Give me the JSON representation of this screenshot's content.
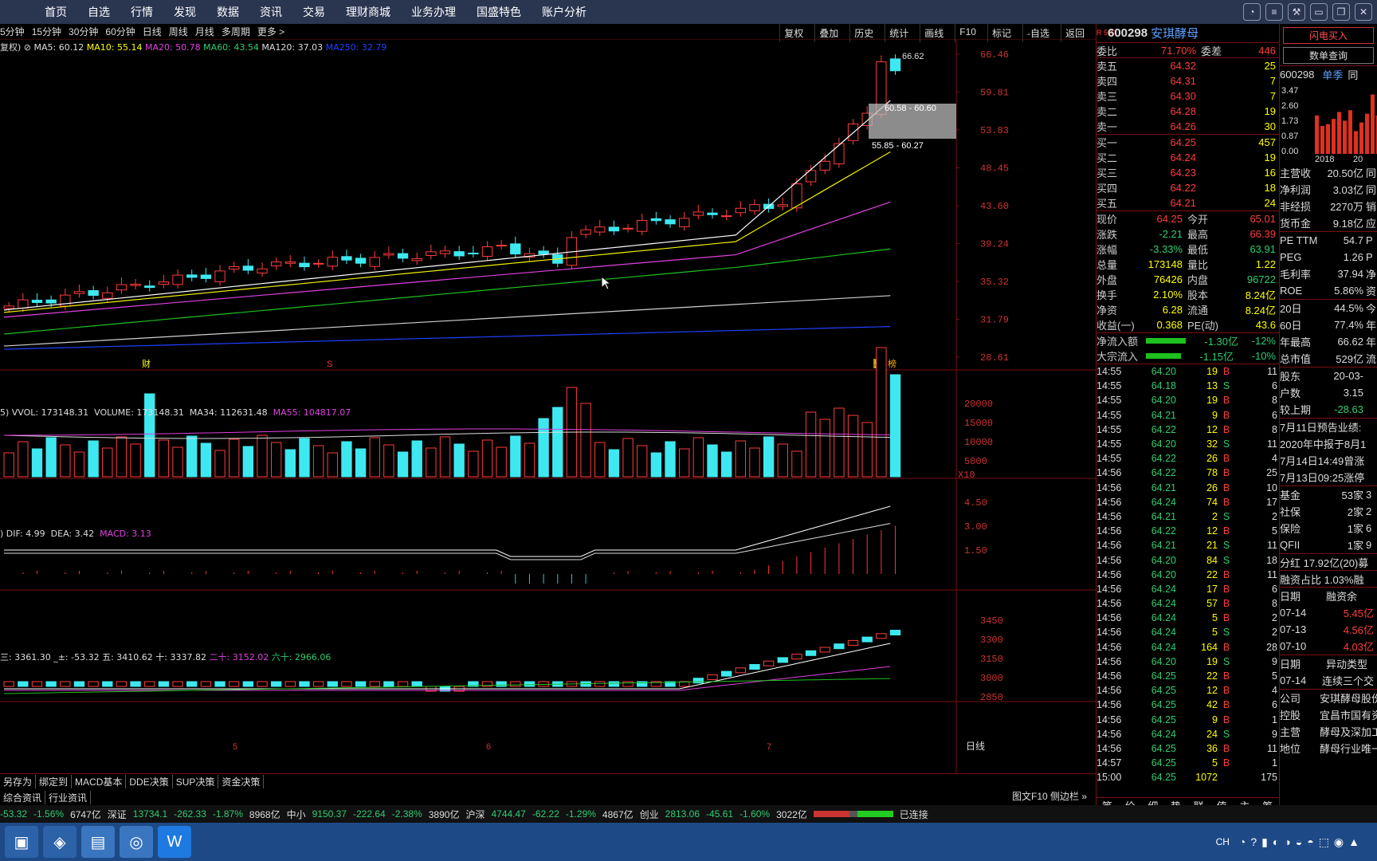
{
  "menu": [
    "首页",
    "自选",
    "行情",
    "发现",
    "数据",
    "资讯",
    "交易",
    "理财商城",
    "业务办理",
    "国盛特色",
    "账户分析"
  ],
  "periods": [
    "5分钟",
    "15分钟",
    "30分钟",
    "60分钟",
    "日线",
    "周线",
    "月线",
    "多周期",
    "更多 >"
  ],
  "tools": [
    "复权",
    "叠加",
    "历史",
    "统计",
    "画线",
    "F10",
    "标记",
    "-自选",
    "返回"
  ],
  "ma_header": {
    "prefix": "复权)",
    "ma5": "MA5: 60.12",
    "ma10": "MA10: 55.14",
    "ma20": "MA20: 50.78",
    "ma60": "MA60: 43.54",
    "ma120": "MA120: 37.03",
    "ma250": "MA250: 32.79"
  },
  "price_axis": [
    "66.46",
    "59.81",
    "53.83",
    "48.45",
    "43.60",
    "39.24",
    "35.32",
    "31.79",
    "28.61"
  ],
  "annotations": {
    "high": "66.62",
    "zone1": "60.58 - 60.60",
    "zone2": "55.85 - 60.27",
    "cai": "财",
    "s": "S",
    "yu": "预",
    "bang": "榜"
  },
  "vol_header": {
    "a": "5) VVOL: 173148.31",
    "b": "VOLUME: 173148.31",
    "c": "MA34: 112631.48",
    "d": "MA55: 104817.07"
  },
  "vol_axis": [
    "20000",
    "15000",
    "10000",
    "5000",
    "X10"
  ],
  "macd_header": {
    "a": ") DIF: 4.99",
    "b": "DEA: 3.42",
    "c": "MACD: 3.13"
  },
  "macd_axis": [
    "4.50",
    "3.00",
    "1.50"
  ],
  "idx_header": {
    "a": "三: 3361.30",
    "b": "_±: -53.32",
    "c": "五: 3410.62",
    "d": "十: 3337.82",
    "e": "二十: 3152.02",
    "f": "六十: 2966.06"
  },
  "idx_axis": [
    "3450",
    "3300",
    "3150",
    "3000",
    "2850"
  ],
  "months": [
    "5",
    "6",
    "7"
  ],
  "rixian": "日线",
  "tabs": [
    "另存为",
    "绑定到",
    "MACD基本",
    "DDE决策",
    "SUP决策",
    "资金决策"
  ],
  "tabs2": [
    "综合资讯",
    "行业资讯"
  ],
  "stock": {
    "code": "600298",
    "name": "安琪酵母",
    "badge": "R 500"
  },
  "weibi": {
    "l": "委比",
    "v": "71.70%",
    "l2": "委差",
    "v2": "446"
  },
  "asks": [
    [
      "卖五",
      "64.32",
      "25"
    ],
    [
      "卖四",
      "64.31",
      "7"
    ],
    [
      "卖三",
      "64.30",
      "7"
    ],
    [
      "卖二",
      "64.28",
      "19"
    ],
    [
      "卖一",
      "64.26",
      "30"
    ]
  ],
  "bids": [
    [
      "买一",
      "64.25",
      "457"
    ],
    [
      "买二",
      "64.24",
      "19"
    ],
    [
      "买三",
      "64.23",
      "16"
    ],
    [
      "买四",
      "64.22",
      "18"
    ],
    [
      "买五",
      "64.21",
      "24"
    ]
  ],
  "quote": [
    [
      "现价",
      "64.25",
      "今开",
      "65.01"
    ],
    [
      "涨跌",
      "-2.21",
      "最高",
      "66.39"
    ],
    [
      "涨幅",
      "-3.33%",
      "最低",
      "63.91"
    ],
    [
      "总量",
      "173148",
      "量比",
      "1.22"
    ],
    [
      "外盘",
      "76426",
      "内盘",
      "96722"
    ],
    [
      "换手",
      "2.10%",
      "股本",
      "8.24亿"
    ],
    [
      "净资",
      "6.28",
      "流通",
      "8.24亿"
    ],
    [
      "收益(一)",
      "0.368",
      "PE(动)",
      "43.6"
    ]
  ],
  "flow": [
    [
      "净流入额",
      "-1.30亿",
      "-12%"
    ],
    [
      "大宗流入",
      "-1.15亿",
      "-10%"
    ]
  ],
  "ticks": [
    [
      "14:55",
      "64.20",
      "19",
      "B",
      "11"
    ],
    [
      "14:55",
      "64.18",
      "13",
      "S",
      "6"
    ],
    [
      "14:55",
      "64.20",
      "19",
      "B",
      "8"
    ],
    [
      "14:55",
      "64.21",
      "9",
      "B",
      "6"
    ],
    [
      "14:55",
      "64.22",
      "12",
      "B",
      "8"
    ],
    [
      "14:55",
      "64.20",
      "32",
      "S",
      "11"
    ],
    [
      "14:55",
      "64.22",
      "26",
      "B",
      "4"
    ],
    [
      "14:56",
      "64.22",
      "78",
      "B",
      "25"
    ],
    [
      "14:56",
      "64.21",
      "26",
      "B",
      "10"
    ],
    [
      "14:56",
      "64.24",
      "74",
      "B",
      "17"
    ],
    [
      "14:56",
      "64.21",
      "2",
      "S",
      "2"
    ],
    [
      "14:56",
      "64.22",
      "12",
      "B",
      "5"
    ],
    [
      "14:56",
      "64.21",
      "21",
      "S",
      "11"
    ],
    [
      "14:56",
      "64.20",
      "84",
      "S",
      "18"
    ],
    [
      "14:56",
      "64.20",
      "22",
      "B",
      "11"
    ],
    [
      "14:56",
      "64.24",
      "17",
      "B",
      "6"
    ],
    [
      "14:56",
      "64.24",
      "57",
      "B",
      "8"
    ],
    [
      "14:56",
      "64.24",
      "5",
      "B",
      "2"
    ],
    [
      "14:56",
      "64.24",
      "5",
      "S",
      "2"
    ],
    [
      "14:56",
      "64.24",
      "164",
      "B",
      "28"
    ],
    [
      "14:56",
      "64.20",
      "19",
      "S",
      "9"
    ],
    [
      "14:56",
      "64.25",
      "22",
      "B",
      "5"
    ],
    [
      "14:56",
      "64.25",
      "12",
      "B",
      "4"
    ],
    [
      "14:56",
      "64.25",
      "42",
      "B",
      "6"
    ],
    [
      "14:56",
      "64.25",
      "9",
      "B",
      "1"
    ],
    [
      "14:56",
      "64.24",
      "24",
      "S",
      "9"
    ],
    [
      "14:56",
      "64.25",
      "36",
      "B",
      "11"
    ],
    [
      "14:57",
      "64.25",
      "5",
      "B",
      "1"
    ],
    [
      "15:00",
      "64.25",
      "1072",
      "",
      "175"
    ]
  ],
  "rtabs": [
    "笔",
    "价",
    "细",
    "势",
    "联",
    "值",
    "主",
    "筹"
  ],
  "far": {
    "btn1": "闪电买入",
    "btn2": "数单查询",
    "code": "600298",
    "season": "单季",
    "col": "同",
    "yaxis": [
      "3.47",
      "2.60",
      "1.73",
      "0.87",
      "0.00"
    ],
    "years": [
      "2018",
      "20"
    ],
    "bars": [
      2.2,
      1.6,
      1.7,
      2.0,
      2.4,
      1.9,
      2.5,
      1.3,
      1.8,
      2.3,
      3.4,
      2.2
    ],
    "fin": [
      [
        "主营收",
        "20.50亿",
        "同"
      ],
      [
        "净利润",
        "3.03亿",
        "同"
      ],
      [
        "非经损",
        "2270万",
        "销"
      ],
      [
        "货币金",
        "9.18亿",
        "应"
      ]
    ],
    "val": [
      [
        "PE TTM",
        "54.7",
        "P"
      ],
      [
        "PEG",
        "1.26",
        "P"
      ],
      [
        "毛利率",
        "37.94",
        "净"
      ],
      [
        "ROE",
        "5.86%",
        "资"
      ]
    ],
    "perf": [
      [
        "20日",
        "44.5%",
        "今"
      ],
      [
        "60日",
        "77.4%",
        "年"
      ],
      [
        "年最高",
        "66.62",
        "年"
      ],
      [
        "总市值",
        "529亿",
        "流"
      ]
    ],
    "holders": [
      [
        "股东",
        "20-03-"
      ],
      [
        "户数",
        "3.15"
      ],
      [
        "较上期",
        "-28.63"
      ]
    ],
    "news": [
      "7月11日预告业绩:",
      "2020年中报于8月1",
      "7月14日14:49曾涨",
      "7月13日09:25涨停"
    ],
    "inst": [
      [
        "基金",
        "53家",
        "3"
      ],
      [
        "社保",
        "2家",
        "2"
      ],
      [
        "保险",
        "1家",
        "6"
      ],
      [
        "QFII",
        "1家",
        "9"
      ]
    ],
    "div": "分红 17.92亿(20)募",
    "margin": "融资占比 1.03%融",
    "mhead": [
      "日期",
      "融资余"
    ],
    "mrows": [
      [
        "07-14",
        "5.45亿"
      ],
      [
        "07-13",
        "4.56亿"
      ],
      [
        "07-10",
        "4.03亿"
      ]
    ],
    "ehead": [
      "日期",
      "异动类型"
    ],
    "erows": [
      [
        "07-14",
        "连续三个交"
      ]
    ],
    "corp": [
      [
        "公司",
        "安琪酵母股份"
      ],
      [
        "控股",
        "宜昌市国有资"
      ],
      [
        "主营",
        "酵母及深加工"
      ],
      [
        "地位",
        "酵母行业唯一"
      ]
    ]
  },
  "bottom": {
    "a": "-53.32",
    "b": "-1.56%",
    "c": "6747亿",
    "d": "深证",
    "e": "13734.1",
    "f": "-262.33",
    "g": "-1.87%",
    "h": "8968亿",
    "i": "中小",
    "j": "9150.37",
    "k": "-222.64",
    "l": "-2.38%",
    "m": "3890亿",
    "n": "沪深",
    "o": "4744.47",
    "p": "-62.22",
    "q": "-1.29%",
    "r": "4867亿",
    "s": "创业",
    "t": "2813.06",
    "u": "-45.61",
    "v": "-1.60%",
    "w": "3022亿",
    "x": "已连接"
  },
  "sidebtn": "图文F10 侧边栏 »",
  "taskbar": {
    "ch": "CH"
  },
  "colors": {
    "up": "#ff3c3c",
    "down": "#3ee8f0",
    "ma5": "#ffffff",
    "ma10": "#f0f000",
    "ma20": "#e040e0",
    "ma60": "#20c020",
    "ma120": "#d0d0d0",
    "ma250": "#2040ff"
  }
}
